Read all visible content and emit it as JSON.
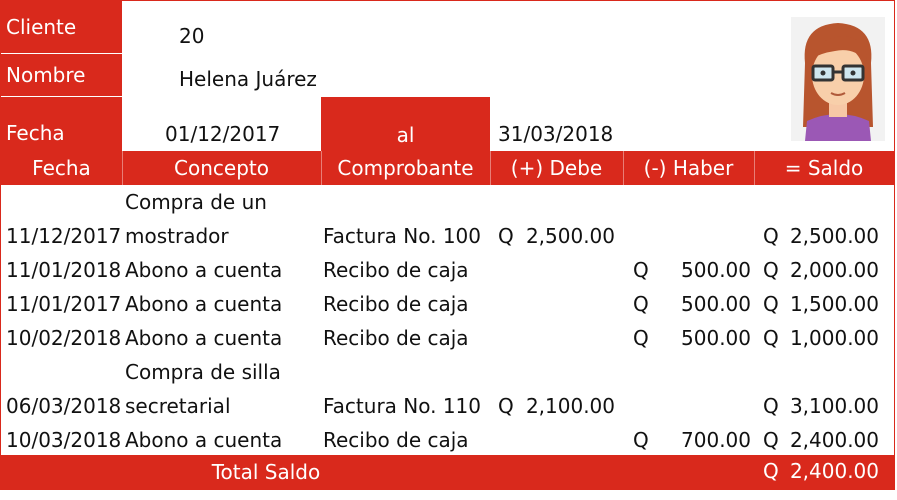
{
  "header": {
    "cliente_label": "Cliente",
    "cliente_value": "20",
    "nombre_label": "Nombre",
    "nombre_value": "Helena Juárez",
    "fecha_label": "Fecha",
    "fecha_desde": "01/12/2017",
    "al_label": "al",
    "fecha_hasta": "31/03/2018"
  },
  "columns": [
    "Fecha",
    "Concepto",
    "Comprobante",
    "(+) Debe",
    "(-) Haber",
    "= Saldo"
  ],
  "currency": "Q",
  "rows": [
    {
      "fecha": "11/12/2017",
      "concepto": [
        "Compra de un",
        "mostrador"
      ],
      "comprobante": "Factura No. 100",
      "debe": "2,500.00",
      "haber": "",
      "saldo": "2,500.00"
    },
    {
      "fecha": "11/01/2018",
      "concepto": [
        "Abono a cuenta"
      ],
      "comprobante": "Recibo de caja",
      "debe": "",
      "haber": "500.00",
      "saldo": "2,000.00"
    },
    {
      "fecha": "11/01/2017",
      "concepto": [
        "Abono a cuenta"
      ],
      "comprobante": "Recibo de caja",
      "debe": "",
      "haber": "500.00",
      "saldo": "1,500.00"
    },
    {
      "fecha": "10/02/2018",
      "concepto": [
        "Abono a cuenta"
      ],
      "comprobante": "Recibo de caja",
      "debe": "",
      "haber": "500.00",
      "saldo": "1,000.00"
    },
    {
      "fecha": "06/03/2018",
      "concepto": [
        "Compra de silla",
        "secretarial"
      ],
      "comprobante": "Factura No. 110",
      "debe": "2,100.00",
      "haber": "",
      "saldo": "3,100.00"
    },
    {
      "fecha": "10/03/2018",
      "concepto": [
        "Abono a cuenta"
      ],
      "comprobante": "Recibo de caja",
      "debe": "",
      "haber": "700.00",
      "saldo": "2,400.00"
    }
  ],
  "footer": {
    "total_label": "Total Saldo",
    "total_value": "2,400.00"
  },
  "colors": {
    "accent": "#d9291c"
  }
}
